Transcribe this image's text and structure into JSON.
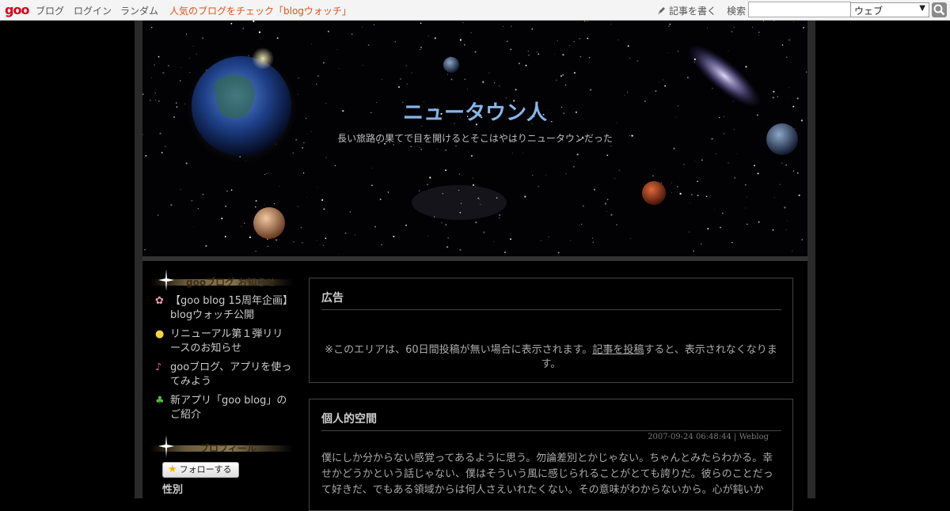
{
  "topbar": {
    "logo": "goo",
    "links": [
      "ブログ",
      "ログイン",
      "ランダム"
    ],
    "promo": "人気のブログをチェック「blogウォッチ」",
    "write": "記事を書く",
    "search_label": "検索",
    "search_value": "",
    "select_value": "ウェブ"
  },
  "blog": {
    "title": "ニュータウン人",
    "subtitle": "長い旅路の果てで目を開けるとそこはやはりニュータウンだった"
  },
  "sidebar": {
    "news_title": "gooブログ お知らせ",
    "news": [
      {
        "icon": "flower-icon",
        "text": "【goo blog 15周年企画】blogウォッチ公開",
        "color": "#f19ab0"
      },
      {
        "icon": "lightbulb-icon",
        "text": "リニューアル第１弾リリースのお知らせ",
        "color": "#ffd23f"
      },
      {
        "icon": "music-note-icon",
        "text": "gooブログ、アプリを使ってみよう",
        "color": "#e85b9a"
      },
      {
        "icon": "clover-icon",
        "text": "新アプリ「goo blog」のご紹介",
        "color": "#58b847"
      }
    ],
    "profile_title": "プロフィール",
    "follow_label": "フォローする",
    "profile_field": "性別"
  },
  "ad": {
    "heading": "広告",
    "text_before": "※このエリアは、60日間投稿が無い場合に表示されます。",
    "link": "記事を投稿",
    "text_after": "すると、表示されなくなります。"
  },
  "post": {
    "title": "個人的空間",
    "meta": "2007-09-24 06:48:44 | Weblog",
    "body": "僕にしか分からない感覚ってあるように思う。勿論差別とかじゃない。ちゃんとみたらわかる。幸せかどうかという話じゃない、僕はそういう風に感じられることがとても誇りだ。彼らのことだって好きだ、でもある領域からは何人さえいれたくない。その意味がわからないから。心が鈍いか"
  },
  "colors": {
    "title": "#86b6ea",
    "promo": "#e0541c",
    "logo": "#d9001b"
  }
}
